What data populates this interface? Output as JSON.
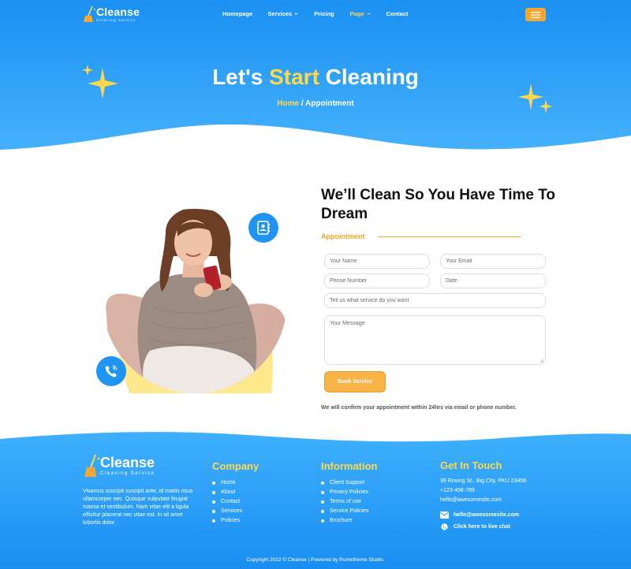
{
  "colors": {
    "primary": "#1f94f3",
    "primary_light": "#43aefc",
    "accent": "#ffd84a",
    "button": "#f9b448",
    "text_dark": "#111111"
  },
  "header": {
    "logo": {
      "name": "Cleanse",
      "tagline": "Cleaning Service"
    },
    "menu": [
      {
        "label": "Homepage",
        "dropdown": false,
        "active": false
      },
      {
        "label": "Services",
        "dropdown": true,
        "active": false
      },
      {
        "label": "Pricing",
        "dropdown": false,
        "active": false
      },
      {
        "label": "Page",
        "dropdown": true,
        "active": true
      },
      {
        "label": "Contact",
        "dropdown": false,
        "active": false
      }
    ],
    "hamburger_icon": "hamburger-menu-icon"
  },
  "hero": {
    "title_prefix": "Let's ",
    "title_accent": "Start",
    "title_suffix": " Cleaning",
    "breadcrumb_home": "Home",
    "breadcrumb_separator": " / ",
    "breadcrumb_current": "Appointment"
  },
  "appointment": {
    "heading": "We’ll Clean So You Have Time To Dream",
    "subheading": "Appointment",
    "fields": {
      "name_placeholder": "Your Name",
      "email_placeholder": "Your Email",
      "phone_placeholder": "Phone Number",
      "date_placeholder": "Date",
      "service_placeholder": "Tell us what service do you want",
      "message_placeholder": "Your Message"
    },
    "submit_label": "Book Service",
    "confirm_note": "We will confirm your appointment within 24hrs via email or phone number.",
    "icons": [
      "contact-book-icon",
      "phone-ringing-icon"
    ]
  },
  "footer": {
    "logo": {
      "name": "Cleanse",
      "tagline": "Cleaning Service"
    },
    "about": "Vivamus suscipit suscipit ante, id mattis risus ullamcorper nec. Quisque vulputate feugiat massa et vestibulum. Nam vitae elit a ligula efficitur placerat nec vitae est. In sit amet lobortis dolor.",
    "company": {
      "title": "Company",
      "links": [
        "Home",
        "About",
        "Contact",
        "Services",
        "Policies"
      ]
    },
    "information": {
      "title": "Information",
      "links": [
        "Client Support",
        "Privacy Policies",
        "Terms of use",
        "Service Policies",
        "Brochure"
      ]
    },
    "touch": {
      "title": "Get In Touch",
      "address": "99 Roving St., Big City, PKU 23456",
      "phone": "+123-456-789",
      "email": "hello@awesomesite.com",
      "email_link": "hello@awesomesite.com",
      "chat_link": "Click here to live chat"
    },
    "copyright": "Copyright 2022 © Cleanse | Powered by Rometheme Studio."
  }
}
